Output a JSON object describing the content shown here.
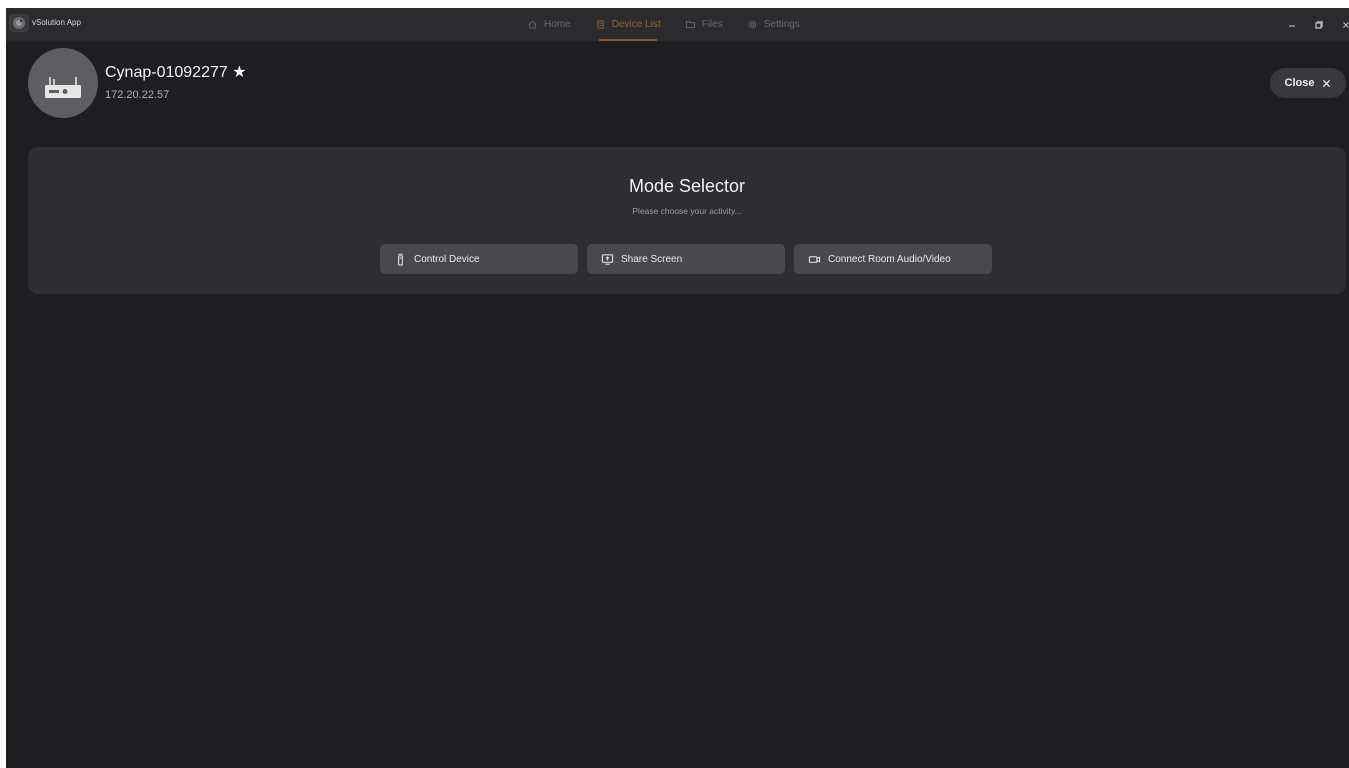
{
  "app": {
    "title": "vSolution App"
  },
  "nav": {
    "items": [
      {
        "label": "Home",
        "icon": "home-icon"
      },
      {
        "label": "Device List",
        "icon": "device-list-icon"
      },
      {
        "label": "Files",
        "icon": "folder-icon"
      },
      {
        "label": "Settings",
        "icon": "gear-icon"
      }
    ],
    "active": "Device List"
  },
  "window_controls": [
    "minimize",
    "restore",
    "close"
  ],
  "device": {
    "name": "Cynap-01092277 ★",
    "ip": "172.20.22.57",
    "icon": "device-icon"
  },
  "close_button": {
    "label": "Close"
  },
  "mode_selector": {
    "title": "Mode Selector",
    "subtitle": "Please choose your activity...",
    "buttons": [
      {
        "label": "Control Device",
        "icon": "remote-icon"
      },
      {
        "label": "Share Screen",
        "icon": "share-screen-icon"
      },
      {
        "label": "Connect Room Audio/Video",
        "icon": "video-camera-icon"
      }
    ]
  },
  "colors": {
    "background": "#1e1e20",
    "titlebar": "#2b2b2d",
    "panel": "#2e2e30",
    "button": "#49494b",
    "accent": "#8c6538"
  }
}
